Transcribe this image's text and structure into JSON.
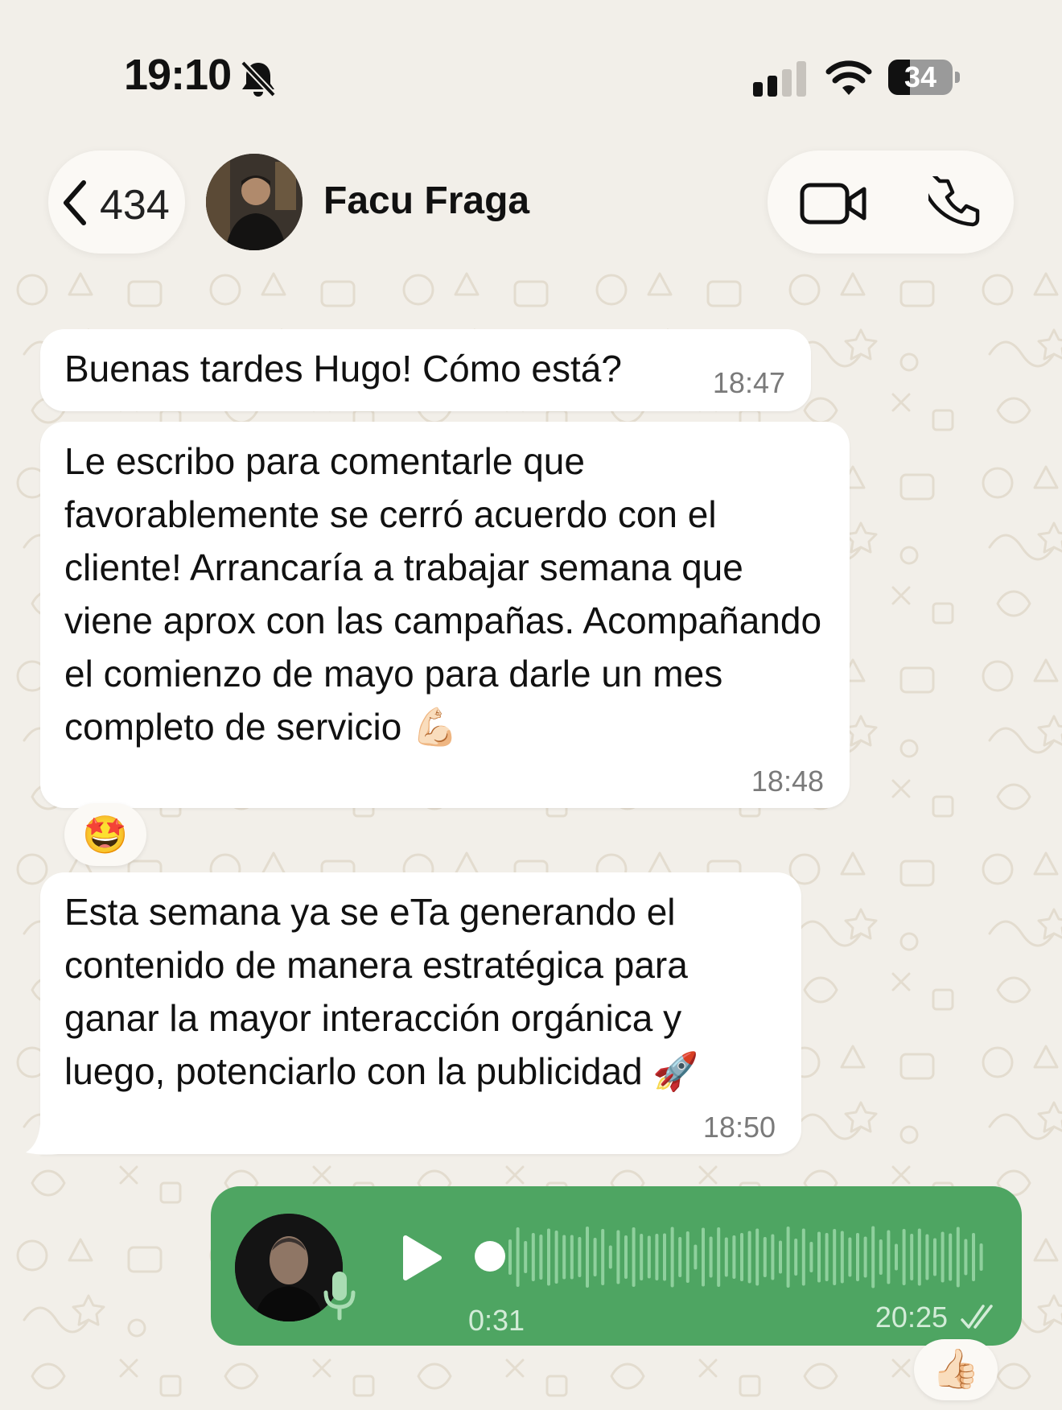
{
  "status_bar": {
    "time": "19:10",
    "battery": "34",
    "battery_level": 0.34
  },
  "header": {
    "back_count": "434",
    "contact_name": "Facu Fraga"
  },
  "messages": [
    {
      "text": "Buenas tardes Hugo! Cómo está?",
      "time": "18:47"
    },
    {
      "text": "Le escribo para comentarle que favorablemente se cerró acuerdo con el cliente! Arrancaría a trabajar semana que viene aprox con las campañas. Acompañando el comienzo de mayo para darle un mes completo de servicio 💪🏻",
      "time": "18:48",
      "reaction": "🤩"
    },
    {
      "text": "Esta semana ya se eTa generando el contenido de manera estratégica para ganar la mayor interacción orgánica y luego, potenciarlo con la publicidad 🚀",
      "time": "18:50"
    }
  ],
  "voice_note": {
    "duration": "0:31",
    "time": "20:25",
    "reaction": "👍🏻",
    "progress": 0
  },
  "colors": {
    "background": "#f2efe9",
    "voice_bubble": "#4ea562",
    "incoming_bubble": "#ffffff"
  },
  "icons": [
    "bell-slash-icon",
    "signal-icon",
    "wifi-icon",
    "chevron-left-icon",
    "video-camera-icon",
    "phone-icon",
    "microphone-icon",
    "play-icon",
    "double-check-icon"
  ]
}
